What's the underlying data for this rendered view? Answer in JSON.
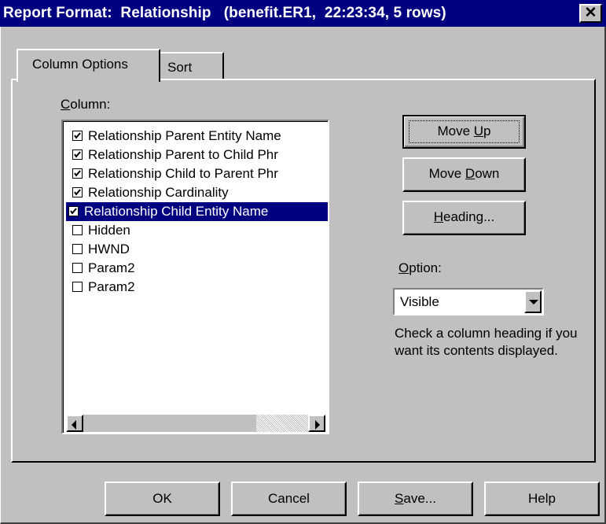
{
  "window": {
    "title": "Report Format:  Relationship   (benefit.ER1,  22:23:34, 5 rows)",
    "close_label": "✕"
  },
  "tabs": [
    {
      "label": "Column Options",
      "active": true
    },
    {
      "label": "Sort",
      "active": false
    }
  ],
  "column_section": {
    "label_prefix": "",
    "label_mnemonic": "C",
    "label_rest": "olumn:",
    "items": [
      {
        "label": "Relationship Parent Entity Name",
        "checked": true,
        "selected": false
      },
      {
        "label": "Relationship Parent to Child Phr",
        "checked": true,
        "selected": false
      },
      {
        "label": "Relationship Child to Parent Phr",
        "checked": true,
        "selected": false
      },
      {
        "label": "Relationship Cardinality",
        "checked": true,
        "selected": false
      },
      {
        "label": "Relationship Child Entity Name",
        "checked": true,
        "selected": true
      },
      {
        "label": "Hidden",
        "checked": false,
        "selected": false
      },
      {
        "label": "HWND",
        "checked": false,
        "selected": false
      },
      {
        "label": "Param2",
        "checked": false,
        "selected": false
      },
      {
        "label": "Param2",
        "checked": false,
        "selected": false
      }
    ]
  },
  "buttons": {
    "move_up": {
      "pre": "Move ",
      "mn": "U",
      "post": "p"
    },
    "move_down": {
      "pre": "Move ",
      "mn": "D",
      "post": "own"
    },
    "heading": {
      "pre": "",
      "mn": "H",
      "post": "eading..."
    }
  },
  "option": {
    "label_mnemonic": "O",
    "label_rest": "ption:",
    "selected": "Visible"
  },
  "hint": "Check a column heading if you want its contents displayed.",
  "footer": {
    "ok": "OK",
    "cancel": "Cancel",
    "save": {
      "mn": "S",
      "post": "ave..."
    },
    "help": "Help"
  },
  "colors": {
    "titlebar": "#000080",
    "face": "#c0c0c0",
    "selection": "#000080"
  }
}
